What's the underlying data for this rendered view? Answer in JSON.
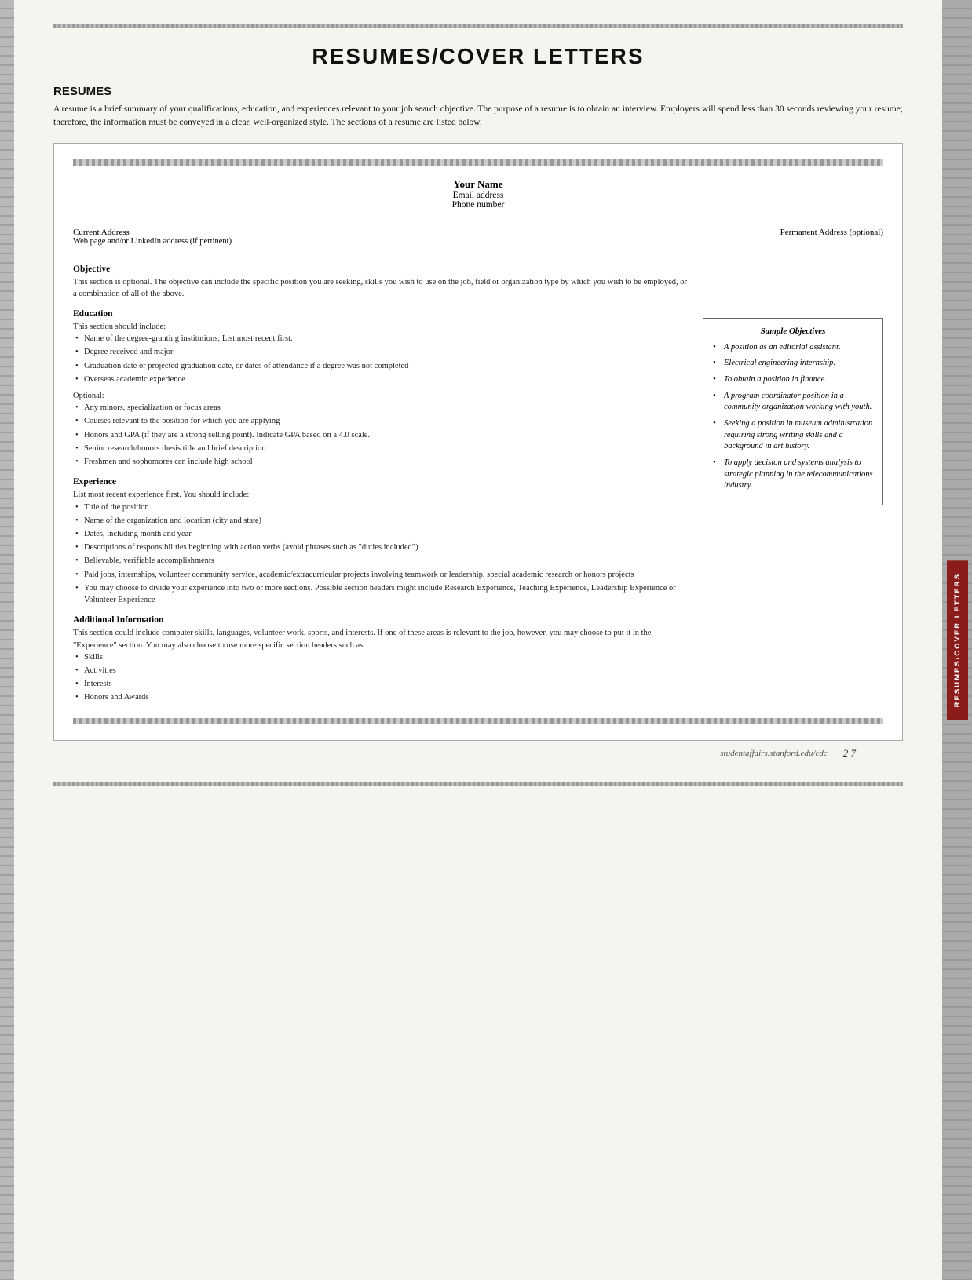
{
  "page": {
    "title": "RESUMES/COVER LETTERS",
    "footer_url": "studentaffairs.stanford.edu/cdc",
    "footer_page": "2  7"
  },
  "resumes_section": {
    "heading": "RESUMES",
    "intro": "A resume is a brief summary of your qualifications, education, and experiences relevant to your job search objective. The purpose of a resume is to obtain an interview. Employers will spend less than 30 seconds reviewing your resume; therefore, the information must be conveyed in a clear, well-organized style. The sections of a resume are listed below."
  },
  "resume_template": {
    "name": "Your Name",
    "email": "Email address",
    "phone": "Phone number",
    "current_address_label": "Current Address",
    "web_label": "Web page and/or LinkedIn address (if pertinent)",
    "permanent_address_label": "Permanent Address (optional)"
  },
  "resume_sections": {
    "objective": {
      "heading": "Objective",
      "text": "This section is optional. The objective can include the specific position you are seeking, skills you wish to use on the job, field or organization type by which you wish to be employed, or a combination of all of the above."
    },
    "education": {
      "heading": "Education",
      "text": "This section should include:",
      "items": [
        "Name of the degree-granting institutions; List most recent first.",
        "Degree received and major",
        "Graduation date or projected graduation date, or dates of attendance if a degree was not completed",
        "Overseas academic experience"
      ],
      "optional_label": "Optional:",
      "optional_items": [
        "Any minors, specialization or focus areas",
        "Courses relevant to the position for which you are applying",
        "Honors and GPA (if they are a strong selling point). Indicate GPA based on a 4.0 scale.",
        "Senior research/honors thesis title and brief description",
        "Freshmen and sophomores can include high school"
      ]
    },
    "experience": {
      "heading": "Experience",
      "text": "List most recent experience first. You should include:",
      "items": [
        "Title of the position",
        "Name of the organization and location (city and state)",
        "Dates, including month and year",
        "Descriptions of responsibilities beginning with action verbs (avoid phrases such as \"duties included\")",
        "Believable, verifiable accomplishments",
        "Paid jobs, internships, volunteer community service, academic/extracurricular projects involving teamwork or leadership, special academic research or honors projects",
        "You may choose to divide your experience into two or more sections. Possible section headers might include Research Experience, Teaching Experience, Leadership Experience or Volunteer Experience"
      ]
    },
    "additional_information": {
      "heading": "Additional Information",
      "text": "This section could include computer skills, languages, volunteer work, sports, and interests. If one of these areas is relevant to the job, however, you may choose to put it in the \"Experience\" section. You may also choose to use more specific section headers such as:",
      "items": [
        "Skills",
        "Activities",
        "Interests",
        "Honors and Awards"
      ]
    }
  },
  "sample_objectives": {
    "box_title": "Sample Objectives",
    "items": [
      "A position as an editorial assistant.",
      "Electrical engineering internship.",
      "To obtain a position in finance.",
      "A program coordinator position in a community organization working with youth.",
      "Seeking a position in museum administration requiring strong writing skills and a background in art history.",
      "To apply decision and systems analysis to strategic planning in the telecommunications industry."
    ]
  },
  "side_label": "RESUMES/COVER LETTERS"
}
